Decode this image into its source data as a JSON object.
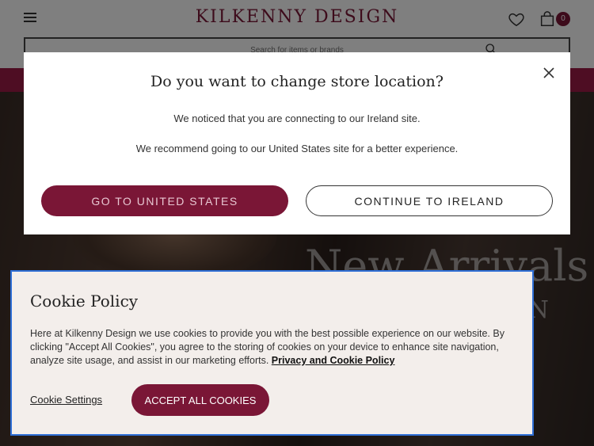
{
  "header": {
    "logo": "KILKENNY DESIGN",
    "search_placeholder": "Search for items or brands",
    "bag_count": "0"
  },
  "hero": {
    "title": "New Arrivals",
    "subtitle": "ON"
  },
  "store_modal": {
    "title": "Do you want to change store location?",
    "line1": "We noticed that you are connecting to our Ireland site.",
    "line2": "We recommend going to our United States site for a better experience.",
    "primary_button": "GO TO UNITED STATES",
    "secondary_button": "CONTINUE TO IRELAND"
  },
  "cookie": {
    "title": "Cookie Policy",
    "text": "Here at Kilkenny Design we use cookies to provide you with the best possible experience on our website. By clicking \"Accept All Cookies\", you agree to the storing of cookies on your device to enhance site navigation, analyze site usage, and assist in our marketing efforts. ",
    "link": "Privacy and Cookie Policy",
    "settings_button": "Cookie Settings",
    "accept_button": "ACCEPT ALL COOKIES"
  },
  "colors": {
    "brand": "#7a1636",
    "promo_bar": "#9c1a47",
    "focus_outline": "#2f6fd6"
  },
  "icons": [
    "menu-icon",
    "heart-icon",
    "bag-icon",
    "search-icon",
    "close-icon"
  ]
}
